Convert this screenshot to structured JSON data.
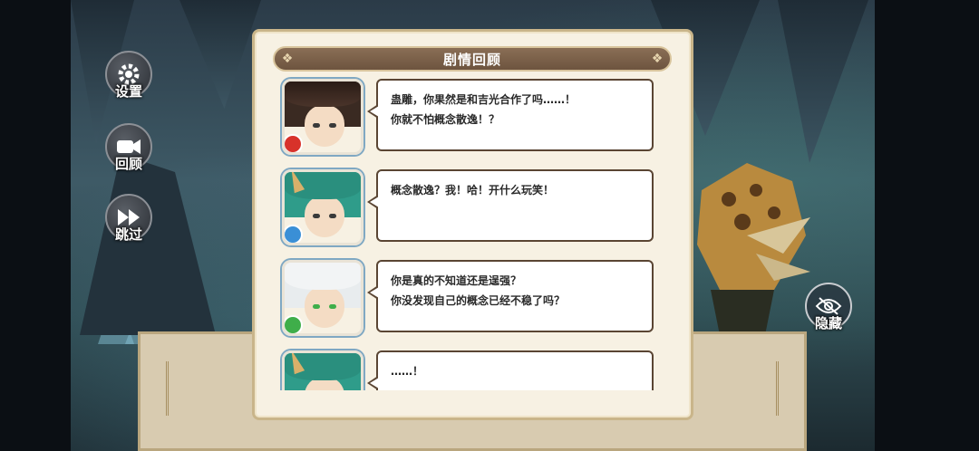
{
  "menu": {
    "settings_label": "设置",
    "review_label": "回顾",
    "skip_label": "跳过",
    "hide_label": "隐藏"
  },
  "story_review": {
    "title": "剧情回顾",
    "entries": [
      {
        "lines": [
          "蛊雕，你果然是和吉光合作了吗……！",
          "你就不怕概念散逸！？"
        ],
        "element_color": "#d8322a"
      },
      {
        "lines": [
          "概念散逸？我！哈！开什么玩笑！"
        ],
        "element_color": "#3a8fd6"
      },
      {
        "lines": [
          "你是真的不知道还是逞强？",
          "你没发现自己的概念已经不稳了吗？"
        ],
        "element_color": "#3fae4a"
      },
      {
        "lines": [
          "……！"
        ],
        "element_color": "#3a8fd6"
      }
    ]
  },
  "colors": {
    "header": "#7a5f49",
    "panel": "#f7f1e3",
    "bubble_border": "#5a4533"
  }
}
